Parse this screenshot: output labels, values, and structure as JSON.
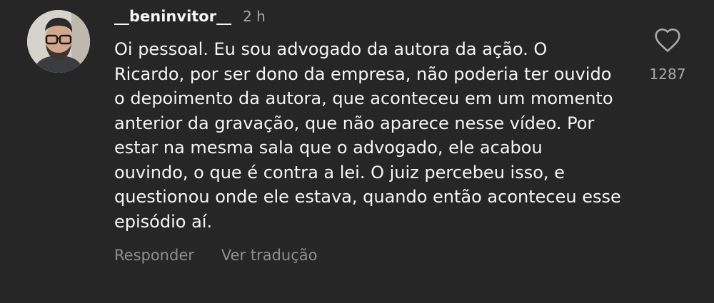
{
  "comment": {
    "username": "__beninvitor__",
    "time": "2 h",
    "text": "Oi pessoal. Eu sou advogado da autora da ação. O Ricardo, por ser dono da empresa, não poderia ter ouvido o depoimento da autora, que aconteceu em um momento anterior da gravação, que não aparece nesse vídeo. Por estar na mesma sala que o advogado, ele acabou ouvindo, o que é contra a lei. O juiz percebeu isso, e questionou onde ele estava, quando então aconteceu esse episódio aí.",
    "actions": {
      "reply_label": "Responder",
      "translate_label": "Ver tradução"
    },
    "likes": {
      "count": "1287",
      "icon": "heart-outline-icon"
    },
    "avatar": {
      "icon": "user-avatar-photo"
    }
  },
  "colors": {
    "background": "#262626",
    "text_primary": "#f5f5f5",
    "text_secondary": "#a8a8a8",
    "action_text": "#8e8e8e"
  }
}
